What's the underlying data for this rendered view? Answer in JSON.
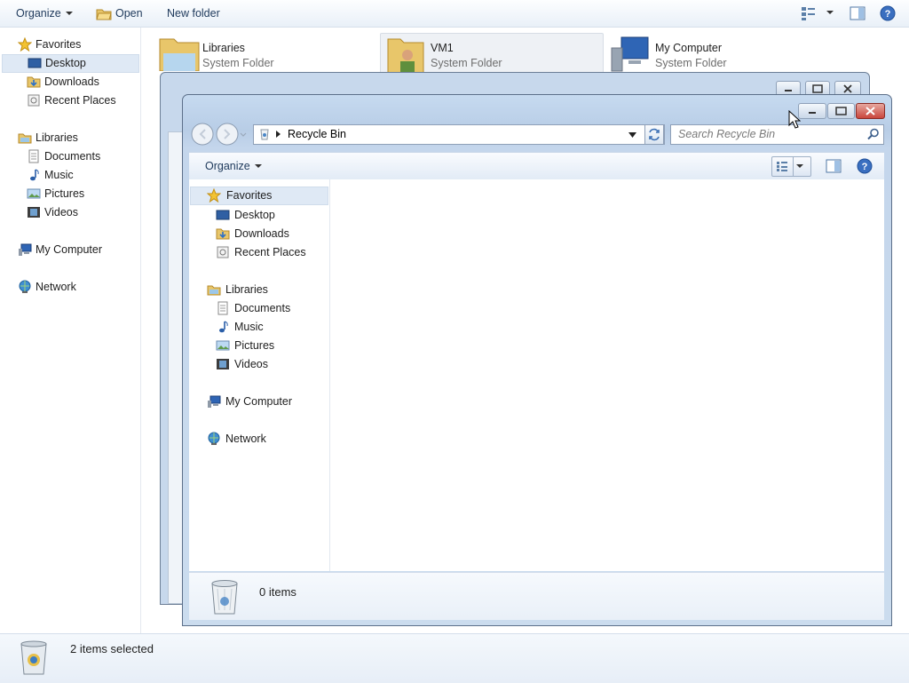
{
  "background_window": {
    "toolbar": {
      "organize": "Organize",
      "open": "Open",
      "new_folder": "New folder"
    },
    "nav": {
      "favorites": "Favorites",
      "desktop": "Desktop",
      "downloads": "Downloads",
      "recent_places": "Recent Places",
      "libraries": "Libraries",
      "documents": "Documents",
      "music": "Music",
      "pictures": "Pictures",
      "videos": "Videos",
      "my_computer": "My Computer",
      "network": "Network"
    },
    "items": [
      {
        "name": "Libraries",
        "type": "System Folder"
      },
      {
        "name": "VM1",
        "type": "System Folder"
      },
      {
        "name": "My Computer",
        "type": "System Folder"
      }
    ],
    "status": "2 items selected"
  },
  "recycle_window": {
    "address": "Recycle Bin",
    "search_placeholder": "Search Recycle Bin",
    "toolbar": {
      "organize": "Organize"
    },
    "nav": {
      "favorites": "Favorites",
      "desktop": "Desktop",
      "downloads": "Downloads",
      "recent_places": "Recent Places",
      "libraries": "Libraries",
      "documents": "Documents",
      "music": "Music",
      "pictures": "Pictures",
      "videos": "Videos",
      "my_computer": "My Computer",
      "network": "Network"
    },
    "details": "0 items"
  },
  "colors": {
    "selection": "#dfe9f5",
    "close_button": "#c9463d",
    "link_text": "#1e395b"
  }
}
